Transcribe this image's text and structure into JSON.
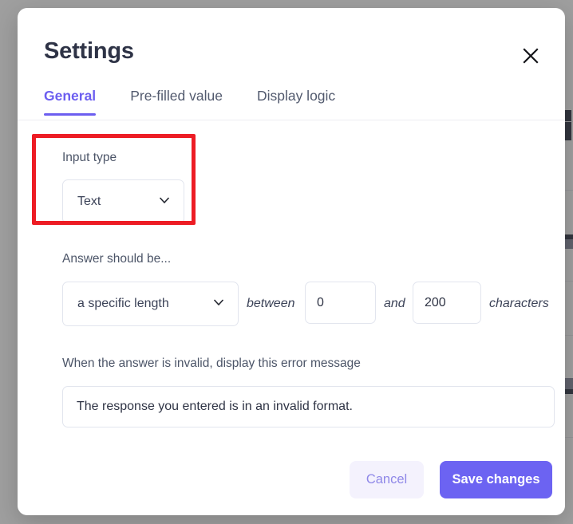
{
  "modal": {
    "title": "Settings",
    "close_icon": "close-x-icon",
    "tabs": [
      {
        "label": "General",
        "active": true
      },
      {
        "label": "Pre-filled value",
        "active": false
      },
      {
        "label": "Display logic",
        "active": false
      }
    ],
    "input_type": {
      "label": "Input type",
      "value": "Text",
      "chevron_icon": "chevron-down-icon"
    },
    "validation": {
      "label": "Answer should be...",
      "rule_value": "a specific length",
      "chevron_icon": "chevron-down-icon",
      "between_word": "between",
      "min_value": "0",
      "and_word": "and",
      "max_value": "200",
      "unit_word": "characters"
    },
    "error_message": {
      "label": "When the answer is invalid, display this error message",
      "value": "The response you entered is in an invalid format."
    },
    "footer": {
      "cancel_label": "Cancel",
      "save_label": "Save changes"
    }
  },
  "annotation": {
    "color": "#ED1C24",
    "target": "input-type-field"
  },
  "theme": {
    "accent": "#6C5EF0",
    "accent_button": "#6C63F2",
    "cancel_bg": "#F4F2FD",
    "title_color": "#2E3346",
    "border": "#E2E5EE"
  }
}
